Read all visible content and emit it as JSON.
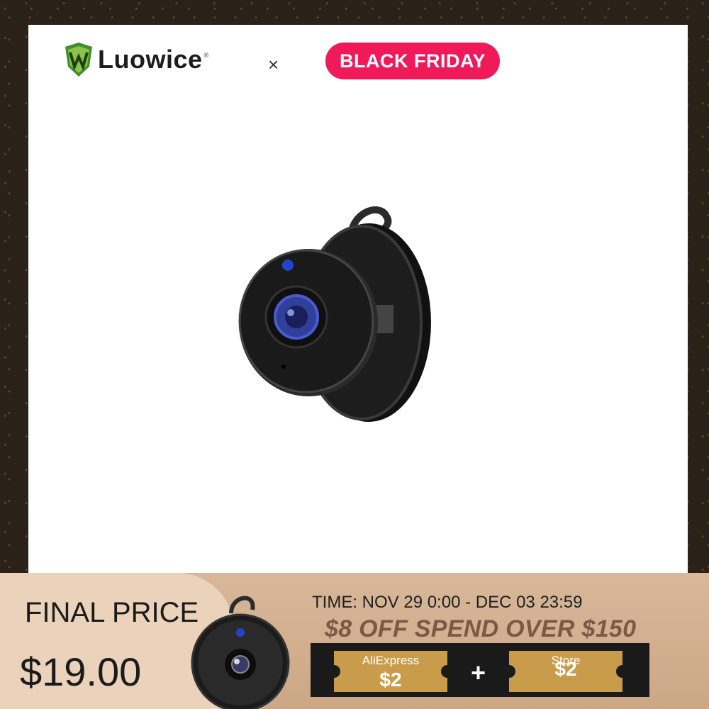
{
  "brand": {
    "name": "Luowice",
    "reg": "®"
  },
  "header": {
    "separator": "×",
    "badge": "BLACK FRIDAY"
  },
  "colors": {
    "badge": "#f0195a",
    "coupon": "#c99c4b",
    "band": "#d8b89a"
  },
  "product": {
    "image": "mini-wifi-camera-icon"
  },
  "footer": {
    "final_label": "FINAL PRICE",
    "final_price": "$19.00",
    "time": "TIME: NOV 29 0:00 - DEC 03 23:59",
    "promo": "$8 OFF SPEND OVER $150",
    "coupon1": {
      "title": "AliExpress",
      "value": "$2"
    },
    "plus": "+",
    "coupon2": {
      "title": "Store",
      "value": "$2"
    }
  }
}
